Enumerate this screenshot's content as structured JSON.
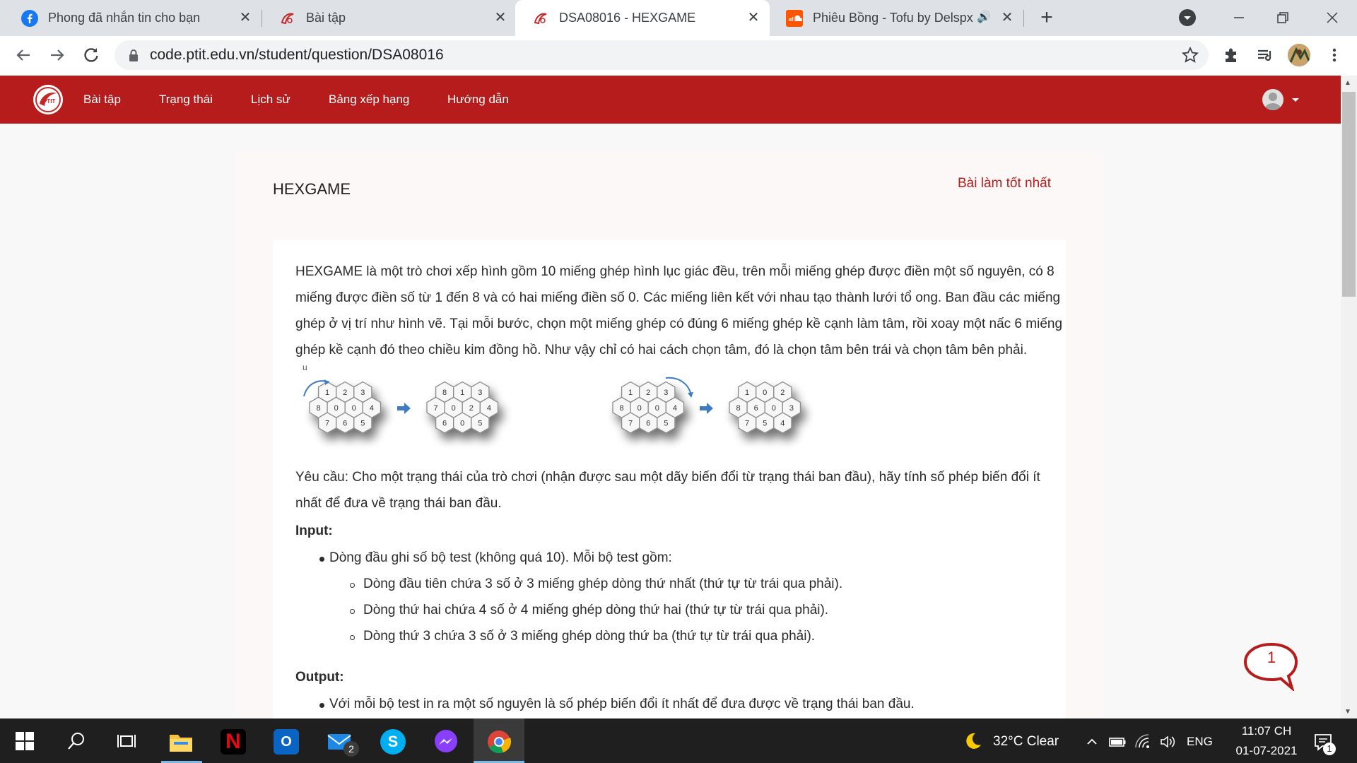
{
  "browser": {
    "tabs": [
      {
        "title": "Phong đã nhắn tin cho bạn",
        "icon": "facebook-icon"
      },
      {
        "title": "Bài tập",
        "icon": "ptit-icon"
      },
      {
        "title": "DSA08016 - HEXGAME",
        "icon": "ptit-icon",
        "active": true
      },
      {
        "title": "Phiêu Bồng - Tofu by Delspx",
        "icon": "soundcloud-icon"
      }
    ],
    "url": "code.ptit.edu.vn/student/question/DSA08016"
  },
  "nav": {
    "items": [
      "Bài tập",
      "Trạng thái",
      "Lịch sử",
      "Bảng xếp hạng",
      "Hướng dẫn"
    ]
  },
  "problem": {
    "title": "HEXGAME",
    "best_link": "Bài làm tốt nhất",
    "intro_lines": [
      "HEXGAME là một trò chơi xếp hình gồm 10 miếng ghép hình lục giác đều, trên mỗi miếng ghép được điền một số nguyên, có 8",
      "miếng được điền số  từ 1 đến 8 và có hai miếng điền số 0. Các miếng liên kết với nhau tạo thành lưới tổ ong. Ban đầu các miếng",
      "ghép ở vị trí như hình vẽ. Tại mỗi bước, chọn một miếng ghép có đúng 6 miếng ghép kề cạnh làm tâm, rồi xoay một nấc 6 miếng",
      "ghép kề cạnh đó theo chiều kim đồng hồ. Như vậy chỉ có hai cách chọn tâm, đó là chọn tâm bên trái và chọn tâm bên phải."
    ],
    "diagram_marker": "u",
    "boards": [
      {
        "rows": [
          [
            "1",
            "2",
            "3"
          ],
          [
            "8",
            "0",
            "0",
            "4"
          ],
          [
            "7",
            "6",
            "5"
          ]
        ]
      },
      {
        "rows": [
          [
            "8",
            "1",
            "3"
          ],
          [
            "7",
            "0",
            "2",
            "4"
          ],
          [
            "6",
            "0",
            "5"
          ]
        ]
      },
      {
        "rows": [
          [
            "1",
            "2",
            "3"
          ],
          [
            "8",
            "0",
            "0",
            "4"
          ],
          [
            "7",
            "6",
            "5"
          ]
        ]
      },
      {
        "rows": [
          [
            "1",
            "0",
            "2"
          ],
          [
            "8",
            "6",
            "0",
            "3"
          ],
          [
            "7",
            "5",
            "4"
          ]
        ]
      }
    ],
    "request_lines": [
      "Yêu cầu: Cho một trạng thái của trò chơi (nhận được sau một dãy biến đổi từ trạng thái ban đầu), hãy tính số phép biến đổi ít",
      "nhất để đưa về trạng thái ban đầu."
    ],
    "input_label": "Input:",
    "input_bullet": "Dòng đầu ghi số bộ test (không quá 10). Mỗi bộ test gồm:",
    "input_sub": [
      "Dòng đầu tiên chứa 3 số ở 3 miếng ghép dòng thứ nhất (thứ tự từ trái qua phải).",
      "Dòng thứ hai chứa 4 số ở 4 miếng ghép dòng thứ hai (thứ tự từ trái qua phải).",
      "Dòng thứ 3 chứa 3 số ở 3 miếng ghép dòng thứ ba (thứ tự từ trái qua phải)."
    ],
    "output_label": "Output:",
    "output_bullet": "Với mỗi bộ test in ra một số nguyên là số phép biến đổi ít nhất để đưa được về trạng thái ban đầu."
  },
  "chat_badge": "1",
  "taskbar": {
    "weather": "32°C  Clear",
    "lang": "ENG",
    "time": "11:07 CH",
    "date": "01-07-2021",
    "mail_badge": "2",
    "notif_badge": "1"
  },
  "colors": {
    "brand_red": "#b71c1c",
    "tab_strip": "#dee1e6",
    "taskbar": "#1f1f1f"
  }
}
